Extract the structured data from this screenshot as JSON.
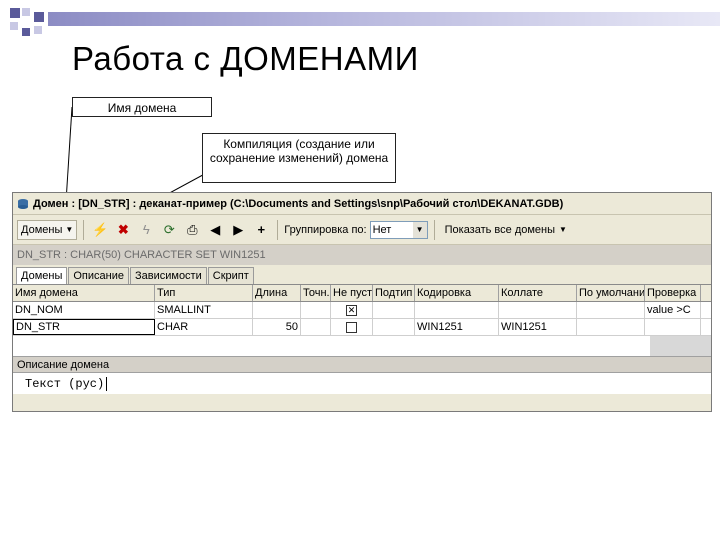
{
  "slide": {
    "title": "Работа с ДОМЕНАМИ",
    "callout_domain_name": "Имя домена",
    "callout_compile": "Компиляция (создание или сохранение изменений) домена"
  },
  "window": {
    "title": "Домен : [DN_STR] : деканат-пример (C:\\Documents and Settings\\snp\\Рабочий стол\\DEKANAT.GDB)",
    "toolbar": {
      "domains_label": "Домены",
      "grouping_label": "Группировка по:",
      "grouping_value": "Нет",
      "show_all_label": "Показать все домены"
    },
    "info_strip": "DN_STR : CHAR(50) CHARACTER SET WIN1251",
    "tabs": [
      {
        "label": "Домены",
        "active": true
      },
      {
        "label": "Описание",
        "active": false
      },
      {
        "label": "Зависимости",
        "active": false
      },
      {
        "label": "Скрипт",
        "active": false
      }
    ],
    "grid": {
      "columns": [
        "Имя домена",
        "Тип",
        "Длина",
        "Точн.",
        "Не пусто",
        "Подтип",
        "Кодировка",
        "Коллате",
        "По умолчанию",
        "Проверка"
      ],
      "rows": [
        {
          "name": "DN_NOM",
          "type": "SMALLINT",
          "length": "",
          "precision": "",
          "not_null": true,
          "subtype": "",
          "charset": "",
          "collate": "",
          "default": "",
          "check": "value >C"
        },
        {
          "name": "DN_STR",
          "type": "CHAR",
          "length": "50",
          "precision": "",
          "not_null": false,
          "subtype": "",
          "charset": "WIN1251",
          "collate": "WIN1251",
          "default": "",
          "check": ""
        }
      ]
    },
    "description": {
      "header": "Описание домена",
      "text": "Текст (рус)"
    }
  },
  "colors": {
    "accent": "#5a5a9a",
    "window_bg": "#ece9d8"
  }
}
